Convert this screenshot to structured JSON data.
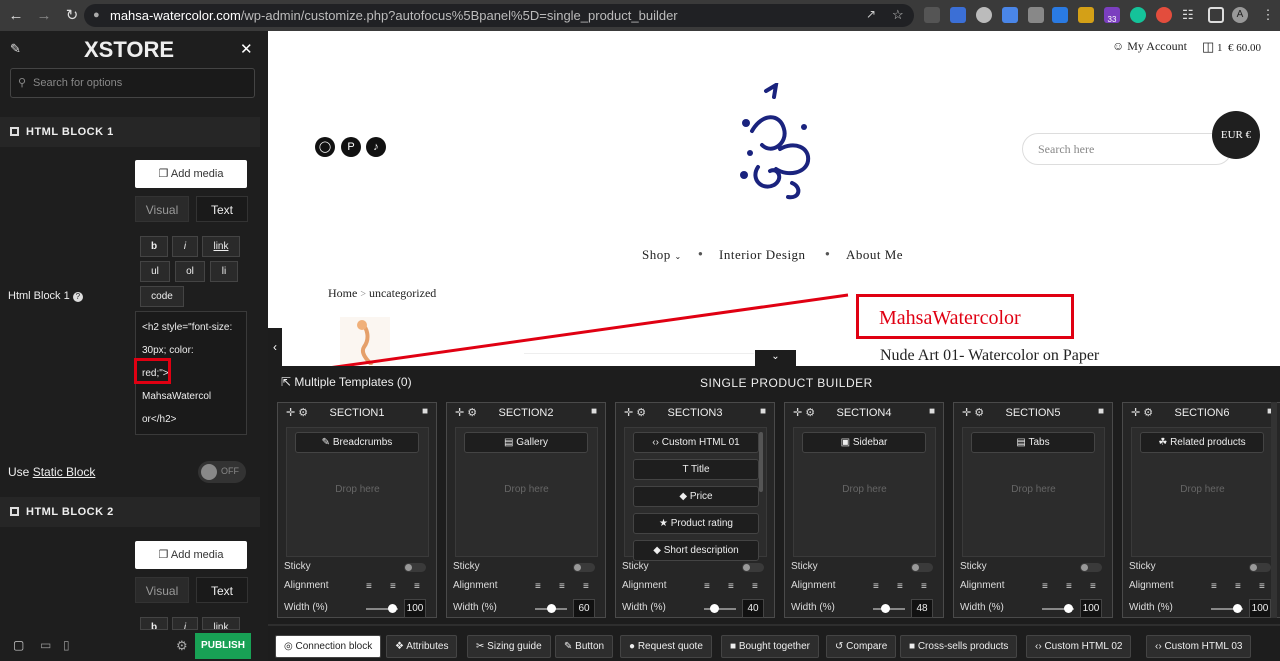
{
  "browser": {
    "url_host": "mahsa-watercolor.com",
    "url_path": "/wp-admin/customize.php?autofocus%5Bpanel%5D=single_product_builder",
    "ext_badge": "33",
    "avatar": "A"
  },
  "sidebar": {
    "logo": "XSTORE",
    "search_placeholder": "Search for options",
    "html_block1_header": "HTML BLOCK 1",
    "add_media": "Add media",
    "tab_visual": "Visual",
    "tab_text": "Text",
    "toolbar": [
      "b",
      "i",
      "link",
      "ul",
      "ol",
      "li",
      "code"
    ],
    "field_label": "Html Block 1",
    "code_lines": [
      "<h2 style=\"font-size:",
      "30px; color:",
      "red;\"> MahsaWatercol",
      "or</h2>"
    ],
    "use_static": "Use",
    "static_link": "Static Block",
    "toggle_off": "OFF",
    "html_block2_header": "HTML BLOCK 2",
    "add_media2": "Add media",
    "tab_visual2": "Visual",
    "tab_text2": "Text",
    "toolbar2": [
      "b",
      "i",
      "link"
    ],
    "publish": "PUBLISH"
  },
  "site": {
    "my_account": "My Account",
    "cart_count": "1",
    "cart_total": "€ 60.00",
    "currency": "EUR €",
    "search_placeholder": "Search here",
    "menu": [
      "Shop",
      "Interior Design",
      "About Me"
    ],
    "breadcrumb_home": "Home",
    "breadcrumb_sep": ">",
    "breadcrumb_cat": "uncategorized",
    "highlight_title": "MahsaWatercolor",
    "product_title": "Nude Art 01- Watercolor on Paper"
  },
  "builder": {
    "templates_label": "Multiple Templates (0)",
    "title": "SINGLE PRODUCT BUILDER",
    "drop_here": "Drop here",
    "sticky": "Sticky",
    "alignment": "Alignment",
    "width": "Width (%)",
    "off": "OFF",
    "sections": [
      {
        "title": "SECTION1",
        "items": [
          "Breadcrumbs"
        ],
        "width": "100",
        "slider": 1.0
      },
      {
        "title": "SECTION2",
        "items": [
          "Gallery"
        ],
        "width": "60",
        "slider": 0.6
      },
      {
        "title": "SECTION3",
        "items": [
          "Custom HTML 01",
          "Title",
          "Price",
          "Product rating",
          "Short description"
        ],
        "width": "40",
        "slider": 0.4
      },
      {
        "title": "SECTION4",
        "items": [
          "Sidebar"
        ],
        "width": "48",
        "slider": 0.48
      },
      {
        "title": "SECTION5",
        "items": [
          "Tabs"
        ],
        "width": "100",
        "slider": 1.0
      },
      {
        "title": "SECTION6",
        "items": [
          "Related products"
        ],
        "width": "100",
        "slider": 1.0
      }
    ],
    "bottom_blocks": [
      "Connection block",
      "Attributes",
      "Sizing guide",
      "Button",
      "Request quote",
      "Bought together",
      "Compare",
      "Cross-sells products",
      "Custom HTML 02",
      "Custom HTML 03"
    ]
  },
  "colors": {
    "accent_red": "#e00012",
    "publish_green": "#18a155",
    "logo_navy": "#1a237e"
  }
}
